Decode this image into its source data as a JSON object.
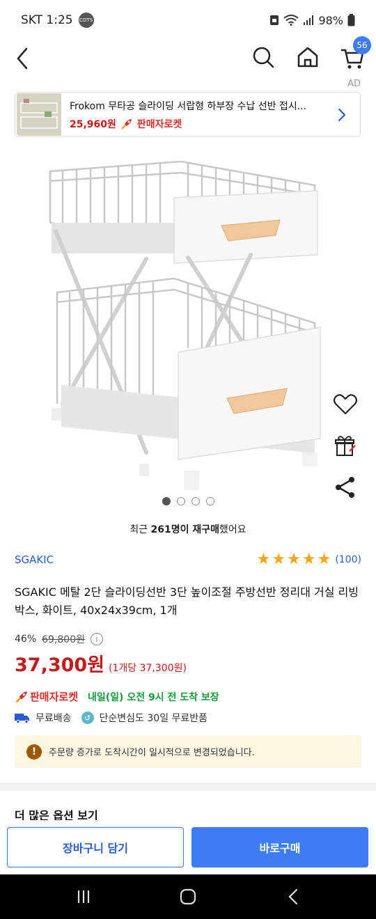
{
  "status_bar": {
    "carrier_time": "SKT 1:25",
    "app_badge": "COTS",
    "battery": "98%"
  },
  "header": {
    "cart_count": "56"
  },
  "ad": {
    "label": "AD",
    "title": "Frokom 무타공 슬라이딩 서랍형 하부장 수납 선반 접시...",
    "price": "25,960원",
    "rocket_label": "판매자로켓"
  },
  "carousel": {
    "total": 4,
    "active_index": 0
  },
  "recent_purchase": {
    "prefix": "최근 ",
    "bold": "261명이 재구매",
    "suffix": "했어요"
  },
  "product": {
    "brand": "SGAKIC",
    "rating": 5,
    "review_count": "(100)",
    "title": "SGAKIC 메탈 2단 슬라이딩선반 3단 높이조절 주방선반 정리대 거실 리빙박스, 화이트, 40x24x39cm, 1개",
    "discount_rate": "46%",
    "original_price": "69,800원",
    "sale_price": "37,300원",
    "unit_price": "(1개당 37,300원)"
  },
  "delivery": {
    "rocket_label": "판매자로켓",
    "arrival": "내일(일) 오전 9시 전 도착 보장",
    "free_shipping": "무료배송",
    "free_return": "단순변심도 30일 무료반품"
  },
  "notice": {
    "text": "주문량 증가로 도착시간이 일시적으로 변경되었습니다."
  },
  "more_options": {
    "label": "더 많은 옵션 보기"
  },
  "bottom_bar": {
    "cart_label": "장바구니 담기",
    "buy_label": "바로구매"
  },
  "colors": {
    "accent_blue": "#3d7cf5",
    "price_red": "#c51b1b",
    "rocket_red": "#e12c2c",
    "arrival_green": "#139c3a",
    "star": "#f5a60c",
    "notice_bg": "#fdf6e3"
  }
}
